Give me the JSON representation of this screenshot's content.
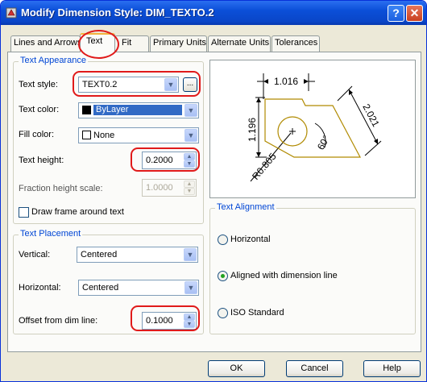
{
  "window": {
    "title": "Modify Dimension Style: DIM_TEXTO.2",
    "help_glyph": "?",
    "close_glyph": "✕"
  },
  "tabs": [
    {
      "label": "Lines and Arrows",
      "active": false
    },
    {
      "label": "Text",
      "active": true
    },
    {
      "label": "Fit",
      "active": false
    },
    {
      "label": "Primary Units",
      "active": false
    },
    {
      "label": "Alternate Units",
      "active": false
    },
    {
      "label": "Tolerances",
      "active": false
    }
  ],
  "text_appearance": {
    "title": "Text Appearance",
    "text_style_label": "Text style:",
    "text_style_value": "TEXT0.2",
    "browse_label": "...",
    "text_color_label": "Text color:",
    "text_color_value": "ByLayer",
    "fill_color_label": "Fill color:",
    "fill_color_value": "None",
    "text_height_label": "Text height:",
    "text_height_value": "0.2000",
    "fraction_label": "Fraction height scale:",
    "fraction_value": "1.0000",
    "frame_label": "Draw frame around text"
  },
  "text_placement": {
    "title": "Text Placement",
    "vertical_label": "Vertical:",
    "vertical_value": "Centered",
    "horizontal_label": "Horizontal:",
    "horizontal_value": "Centered",
    "offset_label": "Offset from dim line:",
    "offset_value": "0.1000"
  },
  "preview": {
    "dim_top": "1.016",
    "dim_left": "1.196",
    "dim_right": "2.021",
    "angle": "60°",
    "radius": "R0.805"
  },
  "text_alignment": {
    "title": "Text Alignment",
    "options": [
      {
        "label": "Horizontal",
        "selected": false
      },
      {
        "label": "Aligned with dimension line",
        "selected": true
      },
      {
        "label": "ISO Standard",
        "selected": false
      }
    ]
  },
  "buttons": {
    "ok": "OK",
    "cancel": "Cancel",
    "help": "Help"
  },
  "colors": {
    "titlebar": "#0b4fd8",
    "group_title": "#0046d5",
    "highlight": "#e01a1a",
    "selection": "#316ac5",
    "geometry": "#b08a00"
  }
}
